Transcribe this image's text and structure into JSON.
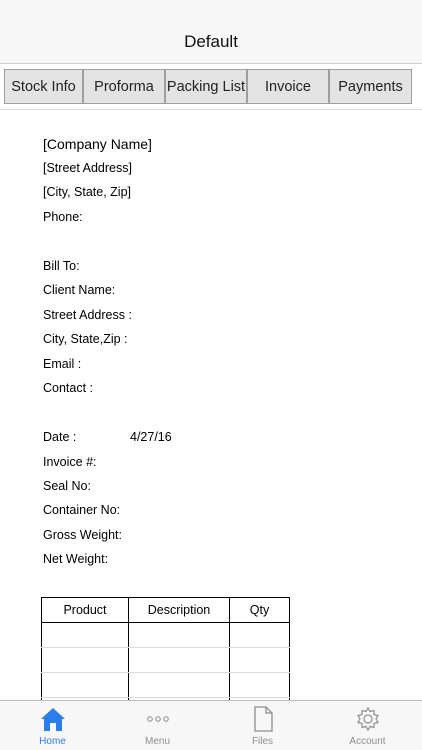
{
  "nav": {
    "title": "Default"
  },
  "tabs": [
    {
      "label": "Stock Info"
    },
    {
      "label": "Proforma"
    },
    {
      "label": "Packing List"
    },
    {
      "label": "Invoice"
    },
    {
      "label": "Payments"
    }
  ],
  "document": {
    "company_lines": [
      "[Company Name]",
      "[Street Address]",
      "[City, State, Zip]",
      "Phone:"
    ],
    "bill_lines": [
      "Bill To:",
      "Client Name:",
      "Street Address :",
      "City, State,Zip :",
      "Email :",
      "Contact :"
    ],
    "date_label": "Date :",
    "date_value": "4/27/16",
    "ship_lines": [
      "Invoice #:",
      "Seal No:",
      "Container No:",
      "Gross Weight:",
      "Net Weight:"
    ],
    "table": {
      "headers": [
        "Product",
        "Description",
        "Qty"
      ]
    }
  },
  "tab_bar": {
    "active_color": "#2b7de9",
    "items": [
      {
        "label": "Home",
        "icon": "home-icon"
      },
      {
        "label": "Menu",
        "icon": "more-dots-icon"
      },
      {
        "label": "Files",
        "icon": "file-icon"
      },
      {
        "label": "Account",
        "icon": "gear-icon"
      }
    ]
  }
}
